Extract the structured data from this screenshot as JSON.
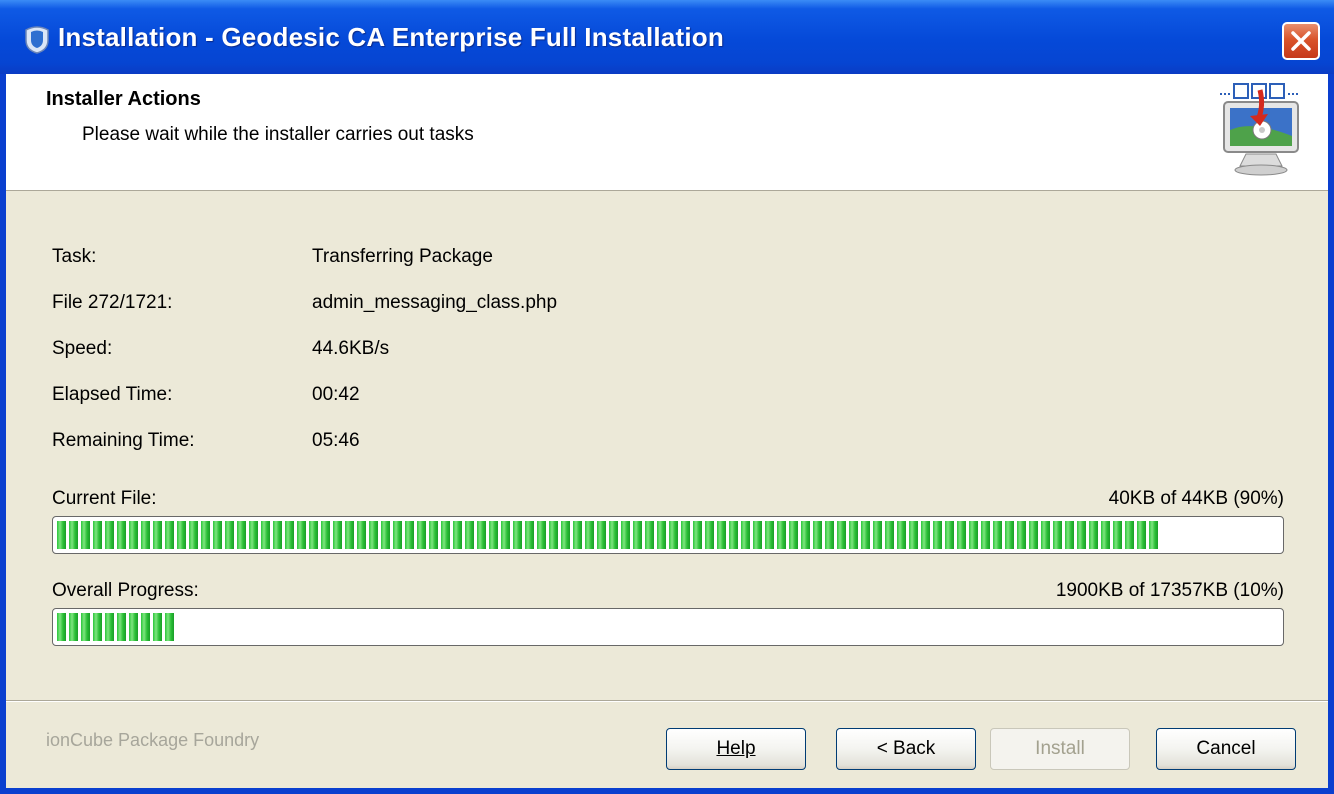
{
  "window": {
    "title": "Installation - Geodesic CA Enterprise Full Installation"
  },
  "header": {
    "title": "Installer Actions",
    "subtitle": "Please wait while the installer carries out tasks"
  },
  "info": [
    {
      "label": "Task:",
      "value": "Transferring Package"
    },
    {
      "label": "File 272/1721:",
      "value": "admin_messaging_class.php"
    },
    {
      "label": "Speed:",
      "value": "44.6KB/s"
    },
    {
      "label": "Elapsed Time:",
      "value": "00:42"
    },
    {
      "label": "Remaining Time:",
      "value": "05:46"
    }
  ],
  "current_file": {
    "label": "Current File:",
    "status": "40KB of 44KB (90%)",
    "progress": 0.9
  },
  "overall": {
    "label": "Overall Progress:",
    "status": "1900KB of 17357KB (10%)",
    "progress": 0.1
  },
  "footer": {
    "brand": "ionCube Package Foundry",
    "help": "Help",
    "back": "< Back",
    "install": "Install",
    "cancel": "Cancel"
  },
  "colors": {
    "titlebar": "#0549d8",
    "progress_green": "#2ac63a",
    "close_button": "#d9542b"
  },
  "icons": [
    "app-shield-icon",
    "close-icon",
    "installer-monitor-icon"
  ]
}
